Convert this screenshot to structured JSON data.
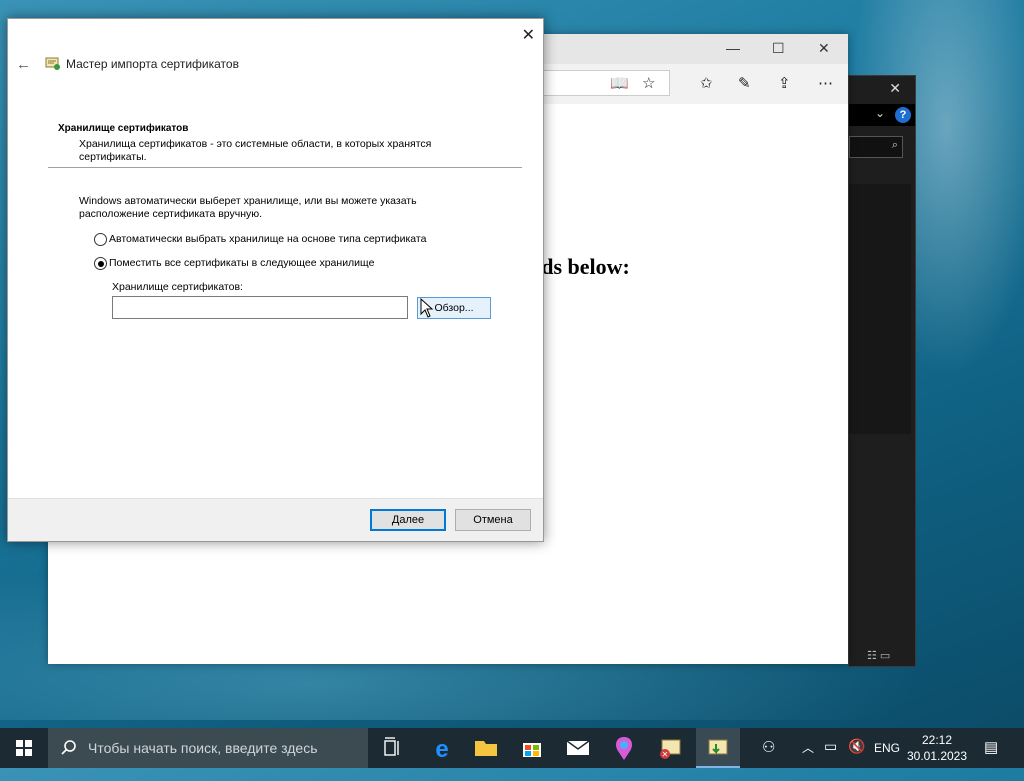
{
  "desktop": {
    "browser_heading": "ands below:"
  },
  "dialog": {
    "title": "Мастер импорта сертификатов",
    "section_title": "Хранилище сертификатов",
    "section_desc": "Хранилища сертификатов - это системные области, в которых хранятся сертификаты.",
    "info_text": "Windows автоматически выберет хранилище, или вы можете указать расположение сертификата вручную.",
    "radio_auto_label": "Автоматически выбрать хранилище на основе типа сертификата",
    "radio_manual_label": "Поместить все сертификаты в следующее хранилище",
    "selected_option": "manual",
    "store_label": "Хранилище сертификатов:",
    "store_value": "",
    "browse_label": "Обзор...",
    "next_label": "Далее",
    "cancel_label": "Отмена"
  },
  "taskbar": {
    "search_placeholder": "Чтобы начать поиск, введите здесь",
    "language": "ENG",
    "time": "22:12",
    "date": "30.01.2023"
  },
  "colors": {
    "accent": "#0078d7",
    "taskbar": "#1b2a33"
  }
}
